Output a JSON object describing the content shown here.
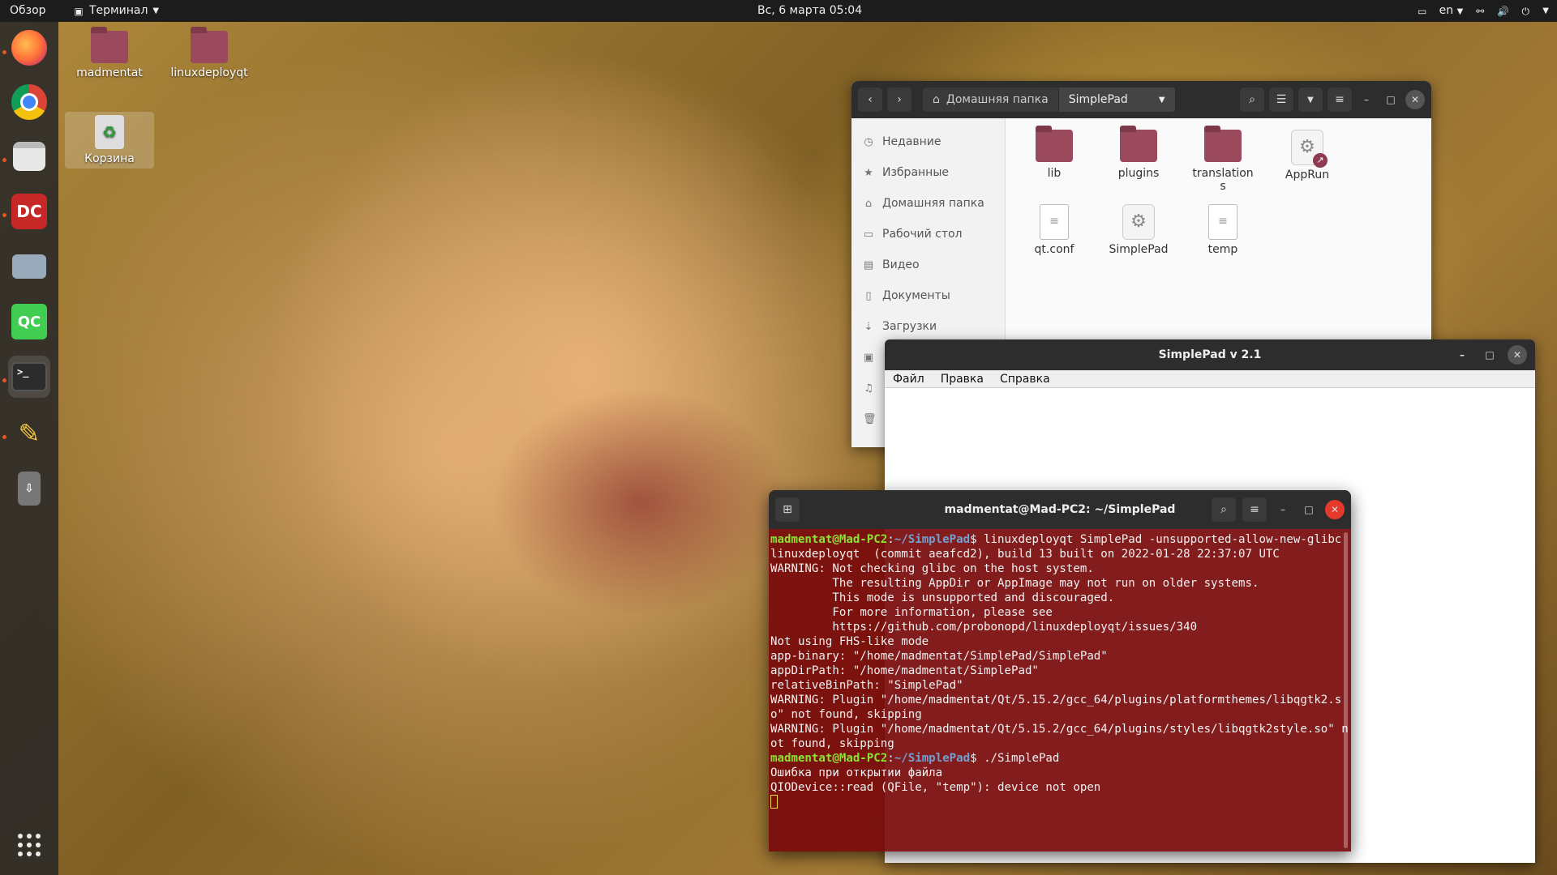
{
  "topbar": {
    "overview": "Обзор",
    "app_name": "Терминал",
    "clock": "Вс, 6 марта  05:04",
    "lang": "en"
  },
  "dock": {
    "items": [
      "firefox",
      "chrome",
      "files",
      "double-commander",
      "disks",
      "qt-creator",
      "terminal",
      "text-editor",
      "usb-drive",
      "show-applications"
    ]
  },
  "desktop": {
    "icons": [
      {
        "label": "madmentat"
      },
      {
        "label": "linuxdeployqt"
      },
      {
        "label": "Корзина"
      }
    ]
  },
  "files": {
    "path_home": "Домашняя папка",
    "path_current": "SimplePad",
    "sidebar": [
      {
        "label": "Недавние",
        "icon": "clock-icon"
      },
      {
        "label": "Избранные",
        "icon": "star-icon"
      },
      {
        "label": "Домашняя папка",
        "icon": "home-icon"
      },
      {
        "label": "Рабочий стол",
        "icon": "desktop-icon"
      },
      {
        "label": "Видео",
        "icon": "video-icon"
      },
      {
        "label": "Документы",
        "icon": "document-icon"
      },
      {
        "label": "Загрузки",
        "icon": "download-icon"
      }
    ],
    "items": [
      {
        "name": "lib",
        "kind": "folder"
      },
      {
        "name": "plugins",
        "kind": "folder"
      },
      {
        "name": "translation\ns",
        "kind": "folder"
      },
      {
        "name": "AppRun",
        "kind": "link"
      },
      {
        "name": "qt.conf",
        "kind": "text"
      },
      {
        "name": "SimplePad",
        "kind": "exec"
      },
      {
        "name": "temp",
        "kind": "text"
      }
    ]
  },
  "simplepad": {
    "title": "SimplePad v 2.1",
    "menu": [
      "Файл",
      "Правка",
      "Справка"
    ]
  },
  "terminal": {
    "title": "madmentat@Mad-PC2: ~/SimplePad",
    "prompt_user": "madmentat@Mad-PC2",
    "prompt_path": "~/SimplePad",
    "cmd1": "$ linuxdeployqt SimplePad -unsupported-allow-new-glibc",
    "output1": "linuxdeployqt  (commit aeafcd2), build 13 built on 2022-01-28 22:37:07 UTC\nWARNING: Not checking glibc on the host system.\n         The resulting AppDir or AppImage may not run on older systems.\n         This mode is unsupported and discouraged.\n         For more information, please see\n         https://github.com/probonopd/linuxdeployqt/issues/340\nNot using FHS-like mode\napp-binary: \"/home/madmentat/SimplePad/SimplePad\"\nappDirPath: \"/home/madmentat/SimplePad\"\nrelativeBinPath: \"SimplePad\"\nWARNING: Plugin \"/home/madmentat/Qt/5.15.2/gcc_64/plugins/platformthemes/libqgtk2.so\" not found, skipping\nWARNING: Plugin \"/home/madmentat/Qt/5.15.2/gcc_64/plugins/styles/libqgtk2style.so\" not found, skipping",
    "cmd2": "$ ./SimplePad",
    "output2": "Ошибка при открытии файла\nQIODevice::read (QFile, \"temp\"): device not open"
  }
}
